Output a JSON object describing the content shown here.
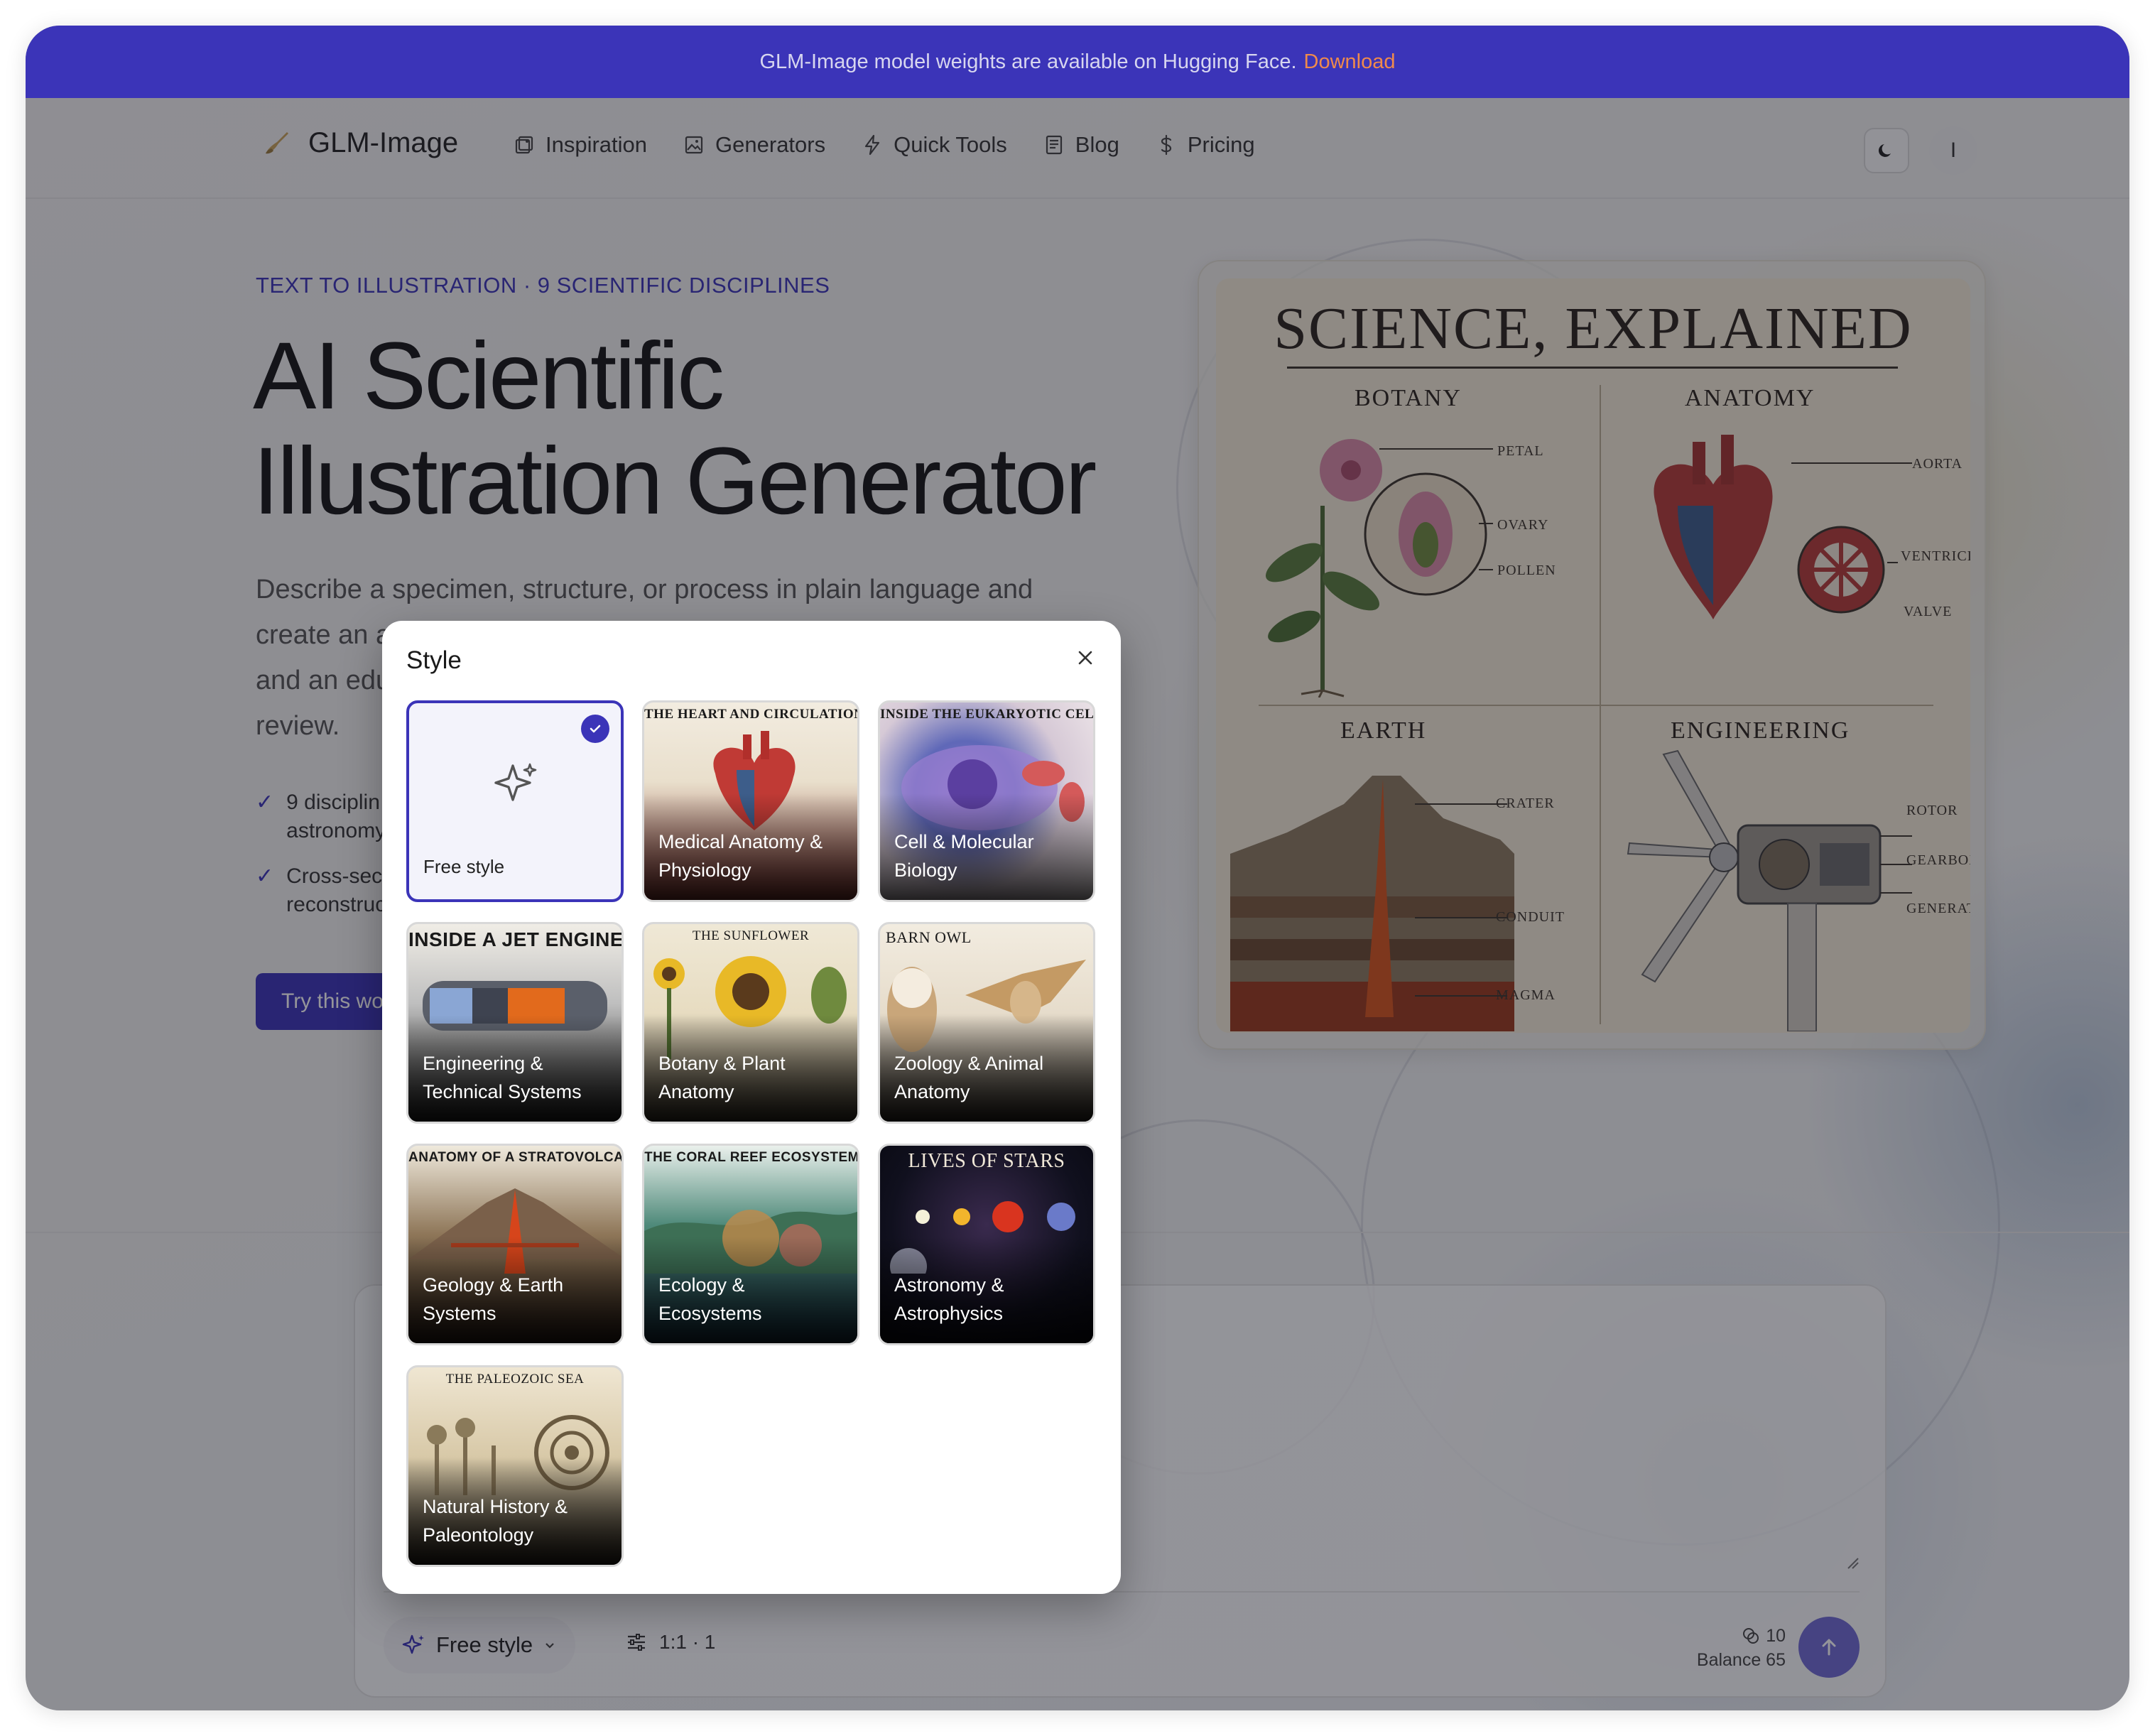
{
  "banner": {
    "text": "GLM-Image model weights are available on Hugging Face.",
    "link": "Download"
  },
  "nav": {
    "brand": "GLM-Image",
    "items": [
      "Inspiration",
      "Generators",
      "Quick Tools",
      "Blog",
      "Pricing"
    ],
    "avatar_initial": "I"
  },
  "hero": {
    "eyebrow": "TEXT TO ILLUSTRATION · 9 SCIENTIFIC DISCIPLINES",
    "title_line1": "AI Scientific",
    "title_line2": "Illustration Generator",
    "desc_line1": "Describe a specimen, structure, or process in plain language and",
    "desc_line2": "create an a",
    "desc_line3": "and an edu",
    "desc_line4": "review.",
    "bullets": [
      {
        "l1": "9 disciplin",
        "l2": "astronomy"
      },
      {
        "l1": "Cross-sec",
        "l2": "reconstruc"
      }
    ],
    "cta": "Try this wo"
  },
  "poster": {
    "title": "SCIENCE, EXPLAINED",
    "quadrants": [
      "BOTANY",
      "ANATOMY",
      "EARTH",
      "ENGINEERING"
    ],
    "callouts": {
      "botany": [
        "PETAL",
        "OVARY",
        "POLLEN"
      ],
      "anatomy": [
        "AORTA",
        "VENTRICLE",
        "VALVE"
      ],
      "earth": [
        "CRATER",
        "CONDUIT",
        "MAGMA"
      ],
      "engineering": [
        "ROTOR",
        "GEARBOX",
        "GENERATOR"
      ]
    }
  },
  "composer": {
    "style_label": "Free style",
    "ratio_label": "1:1 · 1",
    "credits": "10",
    "balance": "Balance 65"
  },
  "modal": {
    "title": "Style",
    "cards": [
      {
        "label": "Free style",
        "thumb": "",
        "selected": true
      },
      {
        "label_l1": "Medical Anatomy &",
        "label_l2": "Physiology",
        "thumb": "THE HEART AND CIRCULATION"
      },
      {
        "label_l1": "Cell & Molecular",
        "label_l2": "Biology",
        "thumb": "INSIDE THE EUKARYOTIC CELL"
      },
      {
        "label_l1": "Engineering &",
        "label_l2": "Technical Systems",
        "thumb": "INSIDE A JET ENGINE"
      },
      {
        "label_l1": "Botany & Plant",
        "label_l2": "Anatomy",
        "thumb": "THE SUNFLOWER"
      },
      {
        "label_l1": "Zoology & Animal",
        "label_l2": "Anatomy",
        "thumb": "BARN OWL"
      },
      {
        "label_l1": "Geology & Earth",
        "label_l2": "Systems",
        "thumb": "ANATOMY OF A STRATOVOLCANO"
      },
      {
        "label_l1": "Ecology &",
        "label_l2": "Ecosystems",
        "thumb": "THE CORAL REEF ECOSYSTEM"
      },
      {
        "label_l1": "Astronomy &",
        "label_l2": "Astrophysics",
        "thumb": "LIVES OF STARS"
      },
      {
        "label_l1": "Natural History &",
        "label_l2": "Paleontology",
        "thumb": "THE PALEOZOIC SEA"
      }
    ]
  },
  "colors": {
    "accent": "#3b34b8",
    "link": "#f08a4b",
    "send": "#6f6ad3"
  }
}
